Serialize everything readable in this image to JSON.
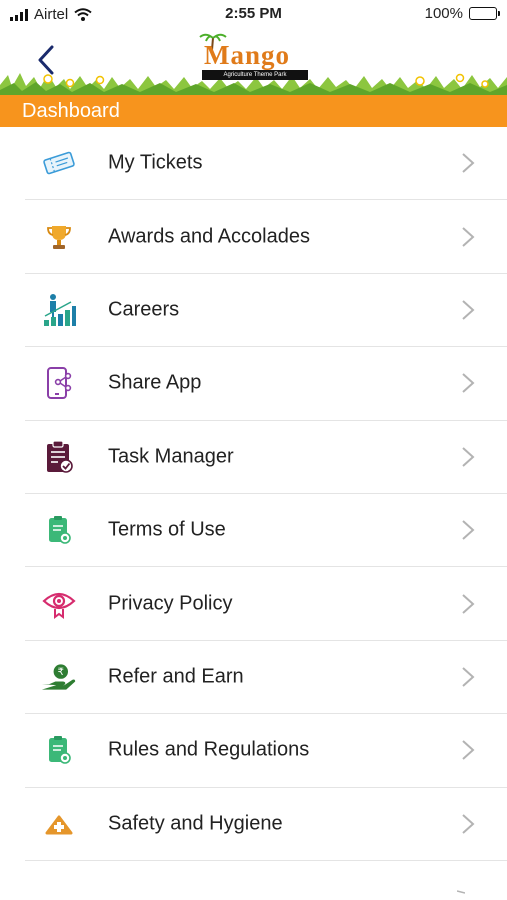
{
  "status_bar": {
    "carrier": "Airtel",
    "time": "2:55 PM",
    "battery": "100%",
    "battery_level": 1.0
  },
  "header": {
    "logo_title": "Mango",
    "logo_subtitle": "Agriculture Theme Park",
    "title": "Dashboard"
  },
  "colors": {
    "accent": "#f7941d",
    "logo": "#e07b1a"
  },
  "menu": {
    "items": [
      {
        "label": "My Tickets",
        "icon": "ticket-icon"
      },
      {
        "label": "Awards and Accolades",
        "icon": "trophy-icon"
      },
      {
        "label": "Careers",
        "icon": "career-growth-icon"
      },
      {
        "label": "Share App",
        "icon": "share-app-icon"
      },
      {
        "label": "Task Manager",
        "icon": "task-clipboard-icon"
      },
      {
        "label": "Terms of Use",
        "icon": "terms-document-icon"
      },
      {
        "label": "Privacy Policy",
        "icon": "privacy-eye-icon"
      },
      {
        "label": "Refer and Earn",
        "icon": "refer-earn-hand-icon"
      },
      {
        "label": "Rules and Regulations",
        "icon": "rules-document-icon"
      },
      {
        "label": "Safety and Hygiene",
        "icon": "safety-kit-icon"
      }
    ]
  }
}
